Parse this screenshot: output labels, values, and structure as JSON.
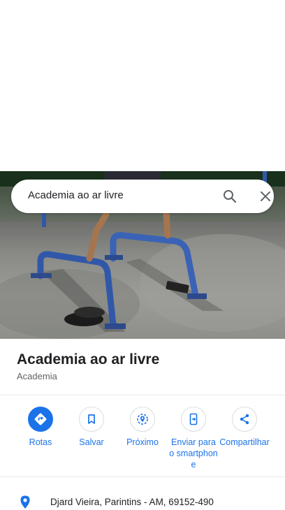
{
  "search": {
    "query": "Academia ao ar livre",
    "search_icon": "search-icon",
    "close_icon": "close-icon"
  },
  "photo": {
    "subject": "outdoor-gym-parallel-bars"
  },
  "place": {
    "title": "Academia ao ar livre",
    "category": "Academia"
  },
  "actions": [
    {
      "label": "Rotas",
      "icon": "directions-icon",
      "primary": true
    },
    {
      "label": "Salvar",
      "icon": "bookmark-icon",
      "primary": false
    },
    {
      "label": "Próximo",
      "icon": "nearby-icon",
      "primary": false
    },
    {
      "label": "Enviar para o smartphone",
      "icon": "send-to-phone-icon",
      "primary": false
    },
    {
      "label": "Compartilhar",
      "icon": "share-icon",
      "primary": false
    }
  ],
  "address": {
    "text": "Djard Vieira, Parintins - AM, 69152-490",
    "icon": "location-pin-icon"
  },
  "colors": {
    "accent": "#1a73e8",
    "text_primary": "#202124",
    "text_secondary": "#5f6368"
  }
}
